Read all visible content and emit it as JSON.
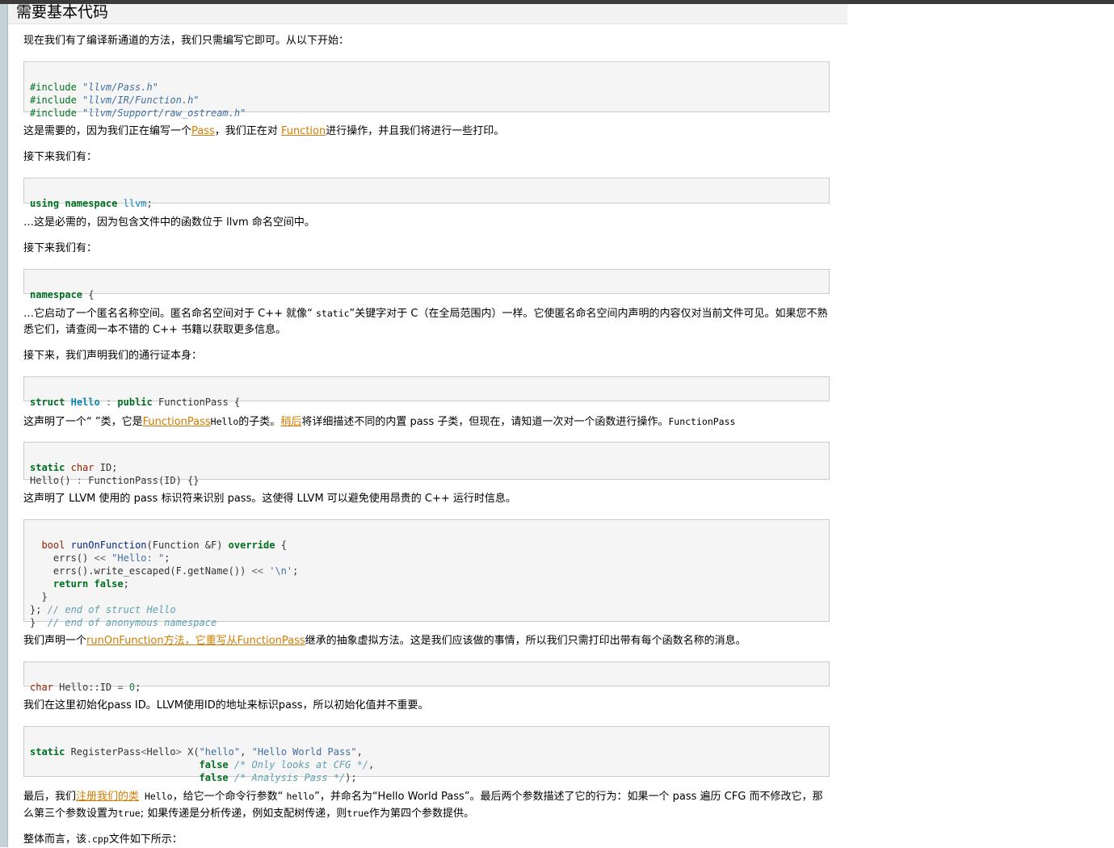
{
  "section": {
    "title": "需要基本代码"
  },
  "paragraphs": {
    "p1": "现在我们有了编译新通道的方法，我们只需编写它即可。从以下开始：",
    "p2_a": "这是需要的，因为我们正在编写一个",
    "p2_link1": "Pass",
    "p2_b": "，我们正在对 ",
    "p2_link2": "Function",
    "p2_c": "进行操作，并且我们将进行一些打印。",
    "p3": "接下来我们有：",
    "p4": "…这是必需的，因为包含文件中的函数位于 llvm 命名空间中。",
    "p5": "接下来我们有：",
    "p6_a": "…它启动了一个匿名名称空间。匿名命名空间对于 C++ 就像“ ",
    "p6_tt": "static",
    "p6_b": "”关键字对于 C（在全局范围内）一样。它使匿名命名空间内声明的内容仅对当前文件可见。如果您不熟悉它们，请查阅一本不错的 C++ 书籍以获取更多信息。",
    "p7": "接下来，我们声明我们的通行证本身：",
    "p8_a": "这声明了一个“ ”类，它是",
    "p8_link1": "FunctionPass",
    "p8_tt1": "Hello",
    "p8_b": "的子类。",
    "p8_link2": "稍后",
    "p8_c": "将详细描述不同的内置 pass 子类，但现在，请知道一次对一个函数进行操作。",
    "p8_tt2": "FunctionPass",
    "p9": "这声明了 LLVM 使用的 pass 标识符来识别 pass。这使得 LLVM 可以避免使用昂贵的 C++ 运行时信息。",
    "p10_a": "我们声明一个",
    "p10_link": "runOnFunction方法，它重写从FunctionPass",
    "p10_b": "继承的抽象虚拟方法。这是我们应该做的事情，所以我们只需打印出带有每个函数名称的消息。",
    "p11": "我们在这里初始化pass ID。LLVM使用ID的地址来标识pass，所以初始化值并不重要。",
    "p12_a": "最后，我们",
    "p12_link": "注册我们的类",
    "p12_tt1": " Hello",
    "p12_b": "，给它一个命令行参数“ ",
    "p12_tt2": "hello",
    "p12_c": "”，并命名为“Hello World Pass”。最后两个参数描述了它的行为：如果一个 pass 遍历 CFG 而不修改它，那么第三个参数设置为",
    "p12_tt3": "true",
    "p12_d": "; 如果传递是分析传递，例如支配树传递，则",
    "p12_tt4": "true",
    "p12_e": "作为第四个参数提供。",
    "p13_a": "整体而言，该",
    "p13_tt": ".cpp",
    "p13_b": "文件如下所示："
  },
  "code": {
    "c1": {
      "inc": "#include",
      "l1": "\"llvm/Pass.h\"",
      "l2": "\"llvm/IR/Function.h\"",
      "l3": "\"llvm/Support/raw_ostream.h\""
    },
    "c2": {
      "using": "using",
      "namespace": "namespace",
      "name": "llvm",
      "end": ";"
    },
    "c3": {
      "namespace": "namespace",
      "brace": " {"
    },
    "c4": {
      "struct": "struct",
      "name": "Hello",
      "colon": " : ",
      "public": "public",
      "base": " FunctionPass {"
    },
    "c5": {
      "static": "static",
      "char": "char",
      "id": " ID;",
      "ctor": "Hello() ",
      "colon": ":",
      "init": " FunctionPass(ID) {}"
    },
    "c6": {
      "bool": "bool",
      "fn": "runOnFunction",
      "params": "(Function &F) ",
      "override": "override",
      "open": " {",
      "errs1": "errs() ",
      "shl1": "<<",
      "hello": "\"Hello: \"",
      "semi1": ";",
      "errs2": "errs().write_escaped(F.getName()) ",
      "shl2": "<<",
      "nl": "'\\n'",
      "semi2": ";",
      "return": "return",
      "false": "false",
      "semi3": ";",
      "close1": "}",
      "close2": "};",
      "cm1": "// end of struct Hello",
      "close3": "}",
      "cm2": "// end of anonymous namespace"
    },
    "c7": {
      "char": "char",
      "rest": " Hello::ID ",
      "eq": "=",
      "zero": "0",
      "semi": ";"
    },
    "c8": {
      "static": "static",
      "reg": " RegisterPass",
      "lt": "<",
      "hello": "Hello",
      "gt": ">",
      "x": " X(",
      "s1": "\"hello\"",
      "comma1": ", ",
      "s2": "\"Hello World Pass\"",
      "comma2": ",",
      "false1": "false",
      "cm1": "/* Only looks at CFG */",
      "comma3": ",",
      "false2": "false",
      "cm2": "/* Analysis Pass */",
      "end": ");"
    }
  }
}
